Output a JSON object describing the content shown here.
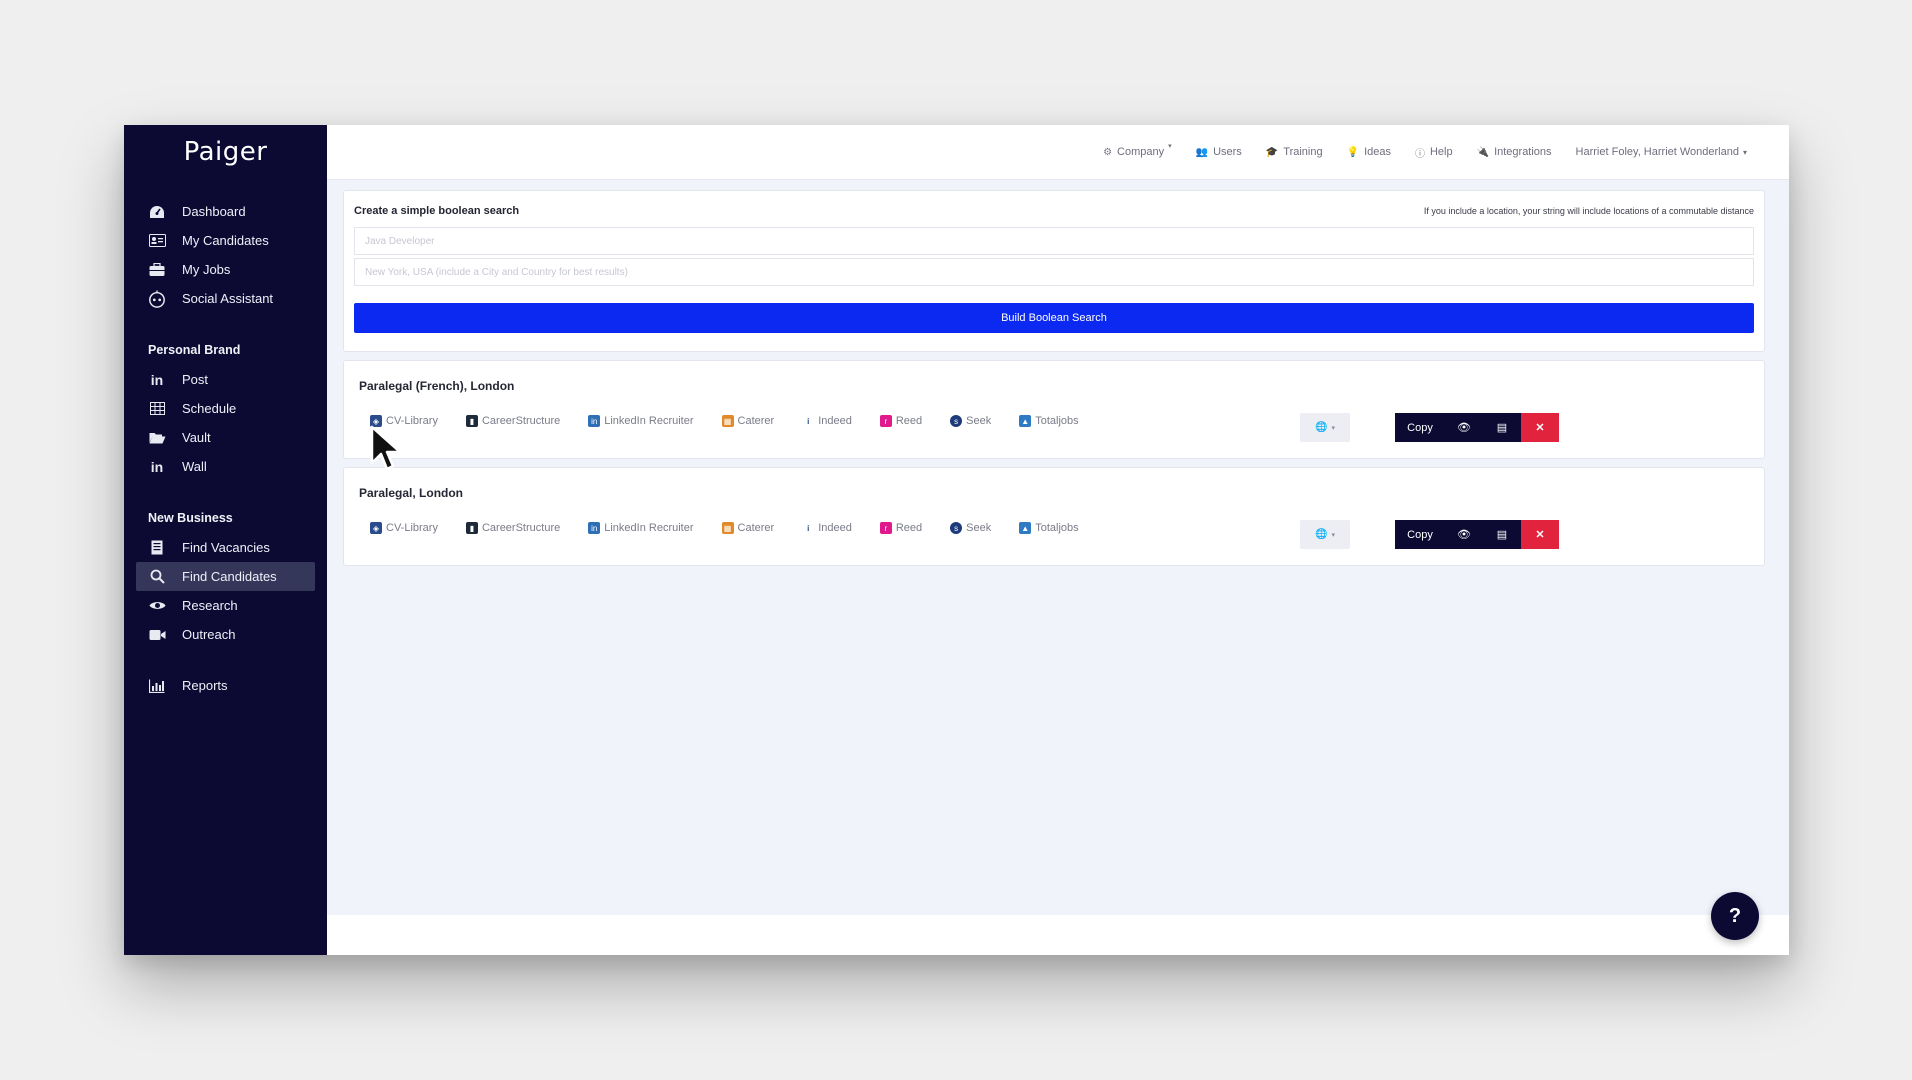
{
  "brand": {
    "logo": "Paiger"
  },
  "sidebar": {
    "main_items": [
      {
        "label": "Dashboard",
        "icon": "dashboard-icon"
      },
      {
        "label": "My Candidates",
        "icon": "id-card-icon"
      },
      {
        "label": "My Jobs",
        "icon": "briefcase-icon"
      },
      {
        "label": "Social Assistant",
        "icon": "robot-icon"
      }
    ],
    "personal_brand": {
      "heading": "Personal Brand",
      "items": [
        {
          "label": "Post",
          "icon": "linkedin-icon"
        },
        {
          "label": "Schedule",
          "icon": "calendar-grid-icon"
        },
        {
          "label": "Vault",
          "icon": "folder-open-icon"
        },
        {
          "label": "Wall",
          "icon": "linkedin-icon"
        }
      ]
    },
    "new_business": {
      "heading": "New Business",
      "items": [
        {
          "label": "Find Vacancies",
          "icon": "document-icon"
        },
        {
          "label": "Find Candidates",
          "icon": "search-icon",
          "active": true
        },
        {
          "label": "Research",
          "icon": "eye-icon"
        },
        {
          "label": "Outreach",
          "icon": "video-icon"
        }
      ]
    },
    "reports": {
      "label": "Reports",
      "icon": "bar-chart-icon"
    }
  },
  "topbar": {
    "company": "Company",
    "users": "Users",
    "training": "Training",
    "ideas": "Ideas",
    "help": "Help",
    "integrations": "Integrations",
    "account": "Harriet Foley, Harriet Wonderland"
  },
  "search": {
    "title": "Create a simple boolean search",
    "note": "If you include a location, your string will include locations of a commutable distance",
    "job_placeholder": "Java Developer",
    "location_placeholder": "New York, USA (include a City and Country for best results)",
    "build_label": "Build Boolean Search"
  },
  "results": [
    {
      "title": "Paralegal (French), London",
      "boards": [
        "CV-Library",
        "CareerStructure",
        "LinkedIn Recruiter",
        "Caterer",
        "Indeed",
        "Reed",
        "Seek",
        "Totaljobs"
      ],
      "copy_label": "Copy"
    },
    {
      "title": "Paralegal, London",
      "boards": [
        "CV-Library",
        "CareerStructure",
        "LinkedIn Recruiter",
        "Caterer",
        "Indeed",
        "Reed",
        "Seek",
        "Totaljobs"
      ],
      "copy_label": "Copy"
    }
  ],
  "colors": {
    "sidebar_bg": "#0c0a33",
    "primary_button": "#0b29f0",
    "delete_button": "#e2233d"
  }
}
